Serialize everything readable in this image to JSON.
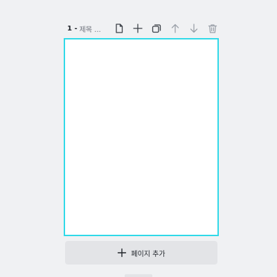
{
  "page": {
    "number": "1 -",
    "title": "제목 ..."
  },
  "toolbar": {
    "icons": [
      "note-icon",
      "plus-icon",
      "duplicate-icon",
      "arrow-up-icon",
      "arrow-down-icon",
      "trash-icon"
    ]
  },
  "add_page": {
    "label": "페이지 추가"
  },
  "colors": {
    "selection_border": "#2fd9e8",
    "background": "#f0f1f3",
    "button_bg": "#e3e4e7"
  }
}
